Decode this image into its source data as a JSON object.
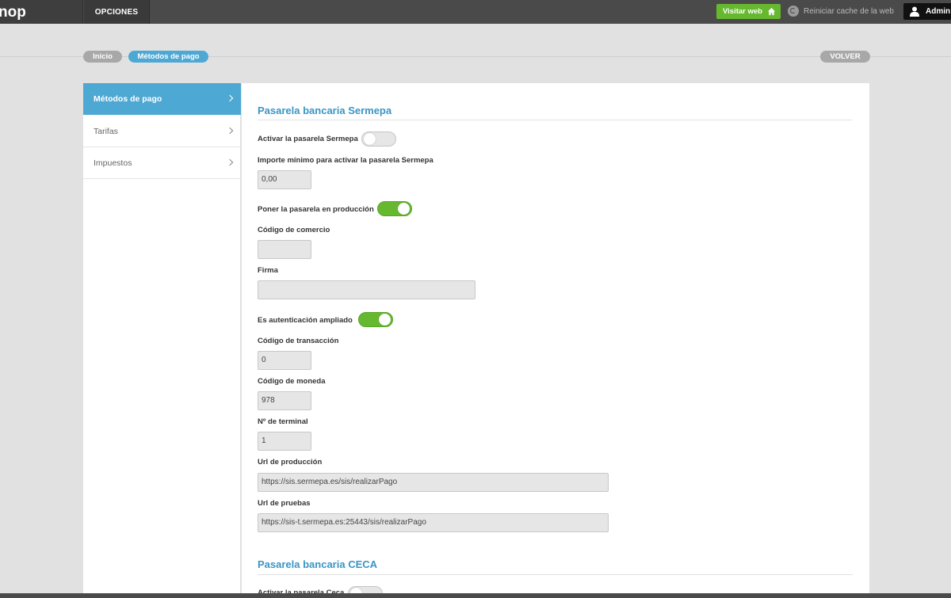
{
  "topbar": {
    "logo_text": "nop",
    "options_label": "OPCIONES",
    "visit_label": "Visitar web",
    "cache_label": "Reiniciar cache de la web",
    "admin_label": "Admin"
  },
  "breadcrumb": {
    "home_label": "Inicio",
    "current_label": "Métodos de pago",
    "back_label": "VOLVER"
  },
  "sidebar": {
    "items": [
      {
        "label": "Métodos de pago",
        "active": true
      },
      {
        "label": "Tarifas",
        "active": false
      },
      {
        "label": "Impuestos",
        "active": false
      }
    ]
  },
  "sermepa": {
    "title": "Pasarela bancaria Sermepa",
    "activate_label": "Activar la pasarela Sermepa",
    "activate_on": false,
    "min_amount_label": "Importe mínimo para activar la pasarela Sermepa",
    "min_amount_value": "0,00",
    "production_label": "Poner la pasarela en producción",
    "production_on": true,
    "merchant_code_label": "Código de comercio",
    "merchant_code_value": "",
    "signature_label": "Firma",
    "signature_value": "",
    "extended_auth_label": "Es autenticación ampliado",
    "extended_auth_on": true,
    "transaction_code_label": "Código de transacción",
    "transaction_code_value": "0",
    "currency_code_label": "Código de moneda",
    "currency_code_value": "978",
    "terminal_label": "Nº de terminal",
    "terminal_value": "1",
    "prod_url_label": "Url de producción",
    "prod_url_value": "https://sis.sermepa.es/sis/realizarPago",
    "test_url_label": "Url de pruebas",
    "test_url_value": "https://sis-t.sermepa.es:25443/sis/realizarPago"
  },
  "ceca": {
    "title": "Pasarela bancaria CECA",
    "activate_label": "Activar la pasarela Ceca",
    "activate_on": false
  },
  "colors": {
    "accent": "#4ea8d4",
    "toggle_on": "#66b92e",
    "topbar": "#4a4a4a"
  }
}
